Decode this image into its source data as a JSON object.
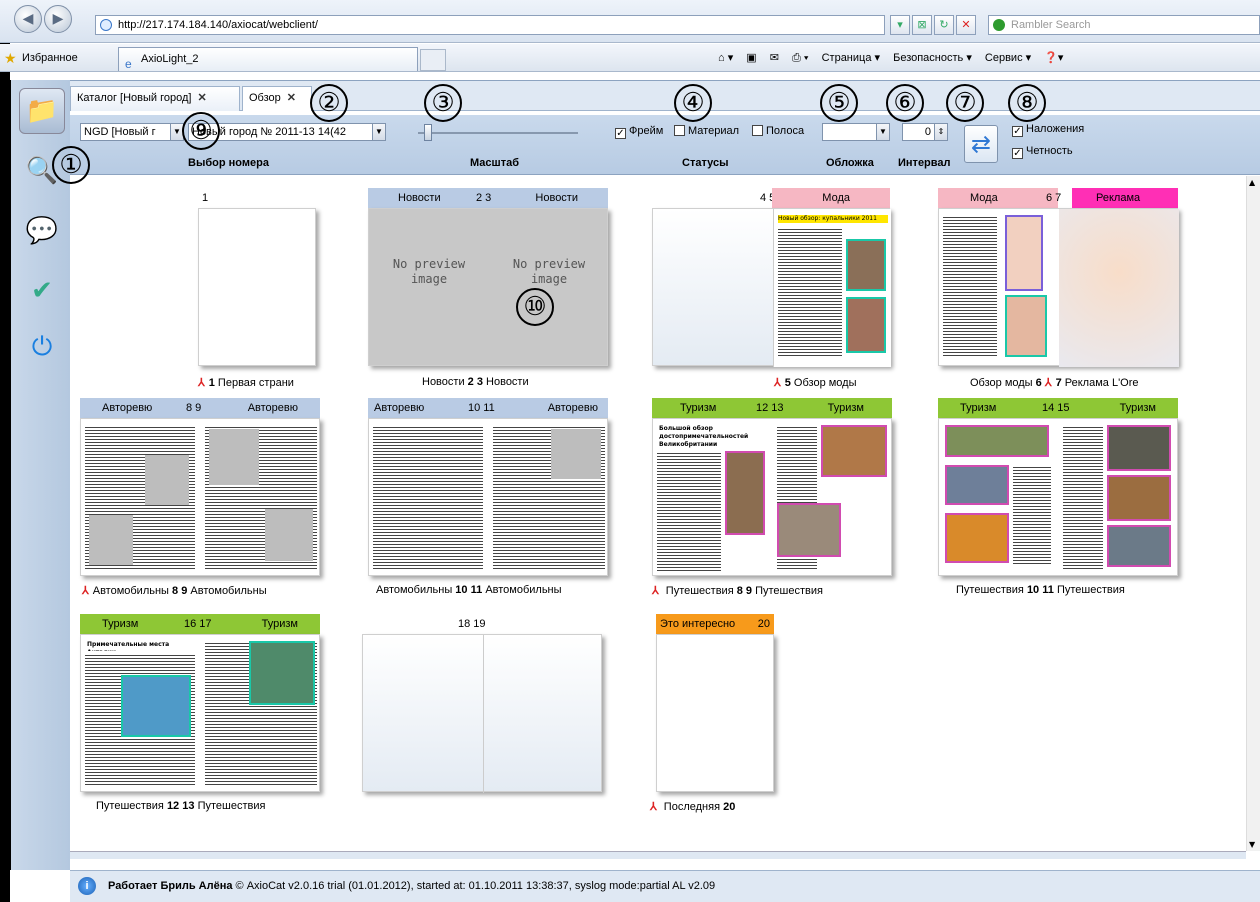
{
  "browser": {
    "address": "http://217.174.184.140/axiocat/webclient/",
    "search_placeholder": "Rambler Search",
    "favorites_label": "Избранное",
    "tab_title": "AxioLight_2",
    "commands": [
      "Страница ▾",
      "Безопасность ▾",
      "Сервис ▾"
    ]
  },
  "app_tabs": [
    {
      "label": "Каталог [Новый город]"
    },
    {
      "label": "Обзор"
    }
  ],
  "toolbar": {
    "edition_select": "NGD [Новый г",
    "issue_select": "Новый город № 2011-13 14(42",
    "issue_label": "Выбор номера",
    "scale_label": "Масштаб",
    "status_frame": "Фрейм",
    "status_material": "Материал",
    "status_stripe": "Полоса",
    "statuses_label": "Статусы",
    "cover_label": "Обложка",
    "interval_value": "0",
    "interval_label": "Интервал",
    "overlaps": "Наложения",
    "parity": "Четность"
  },
  "callouts": [
    "①",
    "②",
    "③",
    "④",
    "⑤",
    "⑥",
    "⑦",
    "⑧",
    "⑨",
    "⑩"
  ],
  "no_preview": "No preview image",
  "rows": [
    [
      {
        "hdr_left": "",
        "hdr_nums": "1",
        "hdr_right": "",
        "caption_left": "1",
        "caption_left_text": "Первая страни",
        "caption_right": "",
        "caption_right_text": ""
      },
      {
        "hdr_left": "Новости",
        "hdr_nums": "2 3",
        "hdr_right": "Новости",
        "caption_left_text": "Новости",
        "caption_left": "2",
        "caption_right": "3",
        "caption_right_text": "Новости"
      },
      {
        "hdr_left": "",
        "hdr_nums": "4 5",
        "hdr_right": "Мода",
        "caption_right": "5",
        "caption_right_text": "Обзор моды"
      },
      {
        "hdr_left": "Мода",
        "hdr_nums": "6 7",
        "hdr_right": "Реклама",
        "caption_left_text": "Обзор моды",
        "caption_left": "6",
        "caption_right": "7",
        "caption_right_text": "Реклама L'Ore"
      }
    ],
    [
      {
        "hdr_left": "Авторевю",
        "hdr_nums": "8 9",
        "hdr_right": "Авторевю",
        "caption_left_text": "Автомобильны",
        "caption_left": "8",
        "caption_right": "9",
        "caption_right_text": "Автомобильны"
      },
      {
        "hdr_left": "Авторевю",
        "hdr_nums": "10 11",
        "hdr_right": "Авторевю",
        "caption_left_text": "Автомобильны",
        "caption_left": "10",
        "caption_right": "11",
        "caption_right_text": "Автомобильны"
      },
      {
        "hdr_left": "Туризм",
        "hdr_nums": "12 13",
        "hdr_right": "Туризм",
        "caption_left_text": "Путешествия",
        "caption_left": "8",
        "caption_right": "9",
        "caption_right_text": "Путешествия"
      },
      {
        "hdr_left": "Туризм",
        "hdr_nums": "14 15",
        "hdr_right": "Туризм",
        "caption_left_text": "Путешествия",
        "caption_left": "10",
        "caption_right": "11",
        "caption_right_text": "Путешествия"
      }
    ],
    [
      {
        "hdr_left": "Туризм",
        "hdr_nums": "16 17",
        "hdr_right": "Туризм",
        "caption_left_text": "Путешествия",
        "caption_left": "12",
        "caption_right": "13",
        "caption_right_text": "Путешествия"
      },
      {
        "hdr_left": "",
        "hdr_nums": "18 19",
        "hdr_right": ""
      },
      {
        "hdr_left": "Это интересно",
        "hdr_nums": "20",
        "hdr_right": "",
        "caption_left_text": "Последняя",
        "caption_left": "20"
      }
    ]
  ],
  "article_titles": {
    "fashion": "Новый обзор: купальники 2011",
    "tourism": "Большой обзор достопримечательностей Великобритании",
    "antalya": "Примечательные места Анталии"
  },
  "status": {
    "user": "Работает Бриль Алёна",
    "info": "© AxioCat v2.0.16 trial (01.01.2012), started at: 01.10.2011 13:38:37, syslog mode:partial   AL v2.09"
  },
  "colors": {
    "news": "#b9cbe4",
    "fashion": "#f6b7c3",
    "ads": "#ff2fb5",
    "tourism": "#8ec735",
    "interesting": "#f79a1b"
  }
}
